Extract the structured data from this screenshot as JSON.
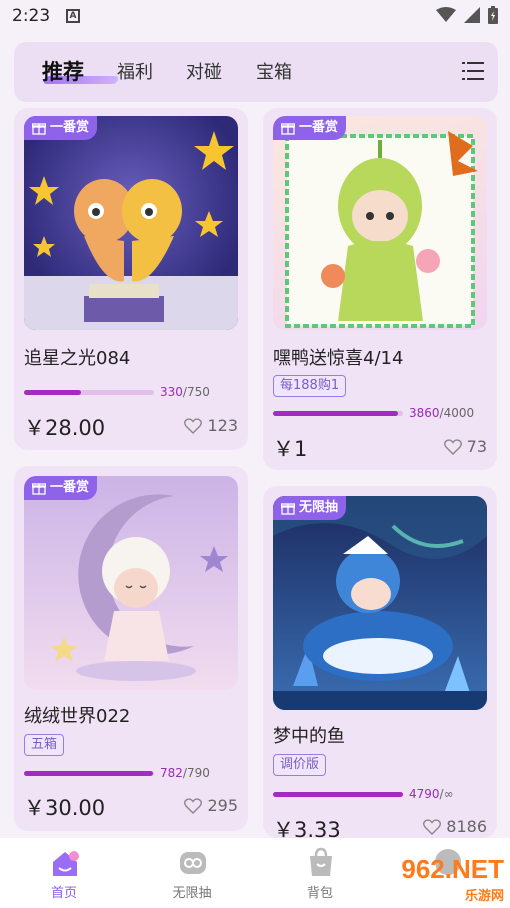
{
  "status": {
    "time": "2:23"
  },
  "tabs": [
    {
      "label": "推荐",
      "active": true
    },
    {
      "label": "福利"
    },
    {
      "label": "对碰"
    },
    {
      "label": "宝箱"
    }
  ],
  "cards": [
    {
      "tag": "一番赏",
      "title": "追星之光084",
      "badge": "",
      "progress_current": "330",
      "progress_total": "/750",
      "progress_fraction": 0.44,
      "price": "￥28.00",
      "likes": "123"
    },
    {
      "tag": "一番赏",
      "title": "嘿鸭送惊喜4/14",
      "badge": "每188购1",
      "progress_current": "3860",
      "progress_total": "/4000",
      "progress_fraction": 0.965,
      "price": "￥1",
      "likes": "73"
    },
    {
      "tag": "一番赏",
      "title": "绒绒世界022",
      "badge": "五箱",
      "progress_current": "782",
      "progress_total": "/790",
      "progress_fraction": 0.99,
      "price": "￥30.00",
      "likes": "295"
    },
    {
      "tag": "无限抽",
      "title": "梦中的鱼",
      "badge": "调价版",
      "progress_current": "4790",
      "progress_total": "/∞",
      "progress_fraction": 1,
      "price": "￥3.33",
      "likes": "8186"
    }
  ],
  "nav": [
    {
      "label": "首页",
      "active": true
    },
    {
      "label": "无限抽"
    },
    {
      "label": "背包"
    }
  ],
  "watermark": {
    "main": "962.NET",
    "sub": "乐游网"
  },
  "colors": {
    "accent": "#8e5af0",
    "progress": "#a22cbf"
  }
}
